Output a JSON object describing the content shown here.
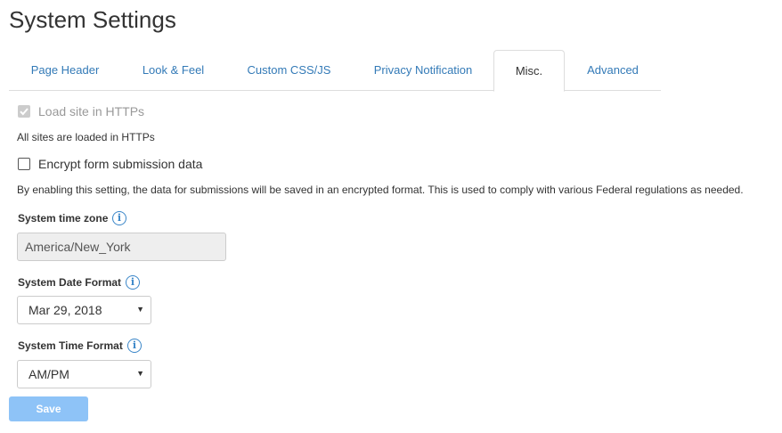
{
  "page": {
    "title": "System Settings"
  },
  "tabs": [
    {
      "label": "Page Header"
    },
    {
      "label": "Look & Feel"
    },
    {
      "label": "Custom CSS/JS"
    },
    {
      "label": "Privacy Notification"
    },
    {
      "label": "Misc.",
      "active": true
    },
    {
      "label": "Advanced"
    }
  ],
  "https": {
    "label": "Load site in HTTPs",
    "checked": true,
    "disabled": true,
    "note": "All sites are loaded in HTTPs"
  },
  "encrypt": {
    "label": "Encrypt form submission data",
    "checked": false,
    "note": "By enabling this setting, the data for submissions will be saved in an encrypted format. This is used to comply with various Federal regulations as needed."
  },
  "timezone": {
    "label": "System time zone",
    "value": "America/New_York"
  },
  "date_format": {
    "label": "System Date Format",
    "value": "Mar 29, 2018"
  },
  "time_format": {
    "label": "System Time Format",
    "value": "AM/PM"
  },
  "save_label": "Save",
  "colors": {
    "link": "#337ab7",
    "info": "#3a86c8",
    "save_button": "#8ec3f7"
  },
  "icons": {
    "info": "info-icon",
    "select_caret": "caret-down-icon",
    "check": "check-icon"
  }
}
